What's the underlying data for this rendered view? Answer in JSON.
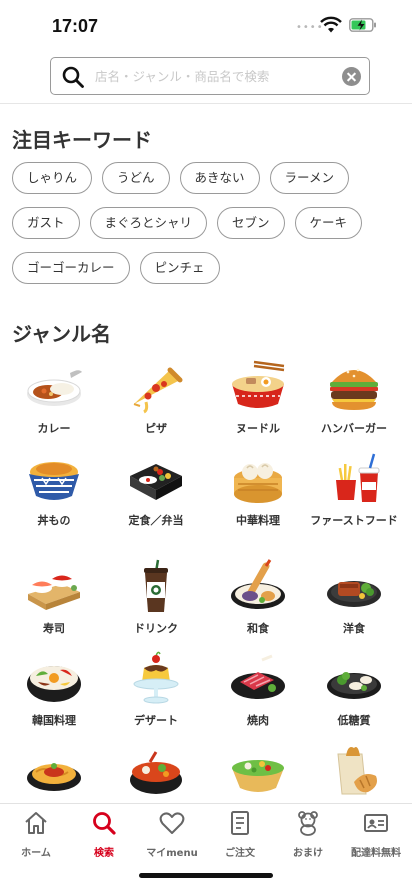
{
  "status": {
    "time": "17:07",
    "dots": "••••"
  },
  "search": {
    "placeholder": "店名・ジャンル・商品名で検索",
    "value": ""
  },
  "keywords": {
    "title": "注目キーワード",
    "items": [
      "しゃりん",
      "うどん",
      "あきない",
      "ラーメン",
      "ガスト",
      "まぐろとシャリ",
      "セブン",
      "ケーキ",
      "ゴーゴーカレー",
      "ピンチェ"
    ]
  },
  "genres": {
    "title": "ジャンル名",
    "items": [
      {
        "label": "カレー",
        "icon": "curry-icon"
      },
      {
        "label": "ピザ",
        "icon": "pizza-icon"
      },
      {
        "label": "ヌードル",
        "icon": "noodle-icon"
      },
      {
        "label": "ハンバーガー",
        "icon": "hamburger-icon"
      },
      {
        "label": "丼もの",
        "icon": "rice-bowl-icon"
      },
      {
        "label": "定食／弁当",
        "icon": "bento-icon"
      },
      {
        "label": "中華料理",
        "icon": "dim-sum-icon"
      },
      {
        "label": "ファーストフード",
        "icon": "fast-food-icon"
      },
      {
        "label": "寿司",
        "icon": "sushi-icon"
      },
      {
        "label": "ドリンク",
        "icon": "drink-icon"
      },
      {
        "label": "和食",
        "icon": "tempura-icon"
      },
      {
        "label": "洋食",
        "icon": "western-dish-icon"
      },
      {
        "label": "韓国料理",
        "icon": "bibimbap-icon"
      },
      {
        "label": "デザート",
        "icon": "pudding-icon"
      },
      {
        "label": "焼肉",
        "icon": "yakiniku-icon"
      },
      {
        "label": "低糖質",
        "icon": "low-carb-icon"
      },
      {
        "label": "",
        "icon": "pasta-icon"
      },
      {
        "label": "",
        "icon": "hot-pot-icon"
      },
      {
        "label": "",
        "icon": "salad-icon"
      },
      {
        "label": "",
        "icon": "bread-icon"
      }
    ]
  },
  "tabbar": {
    "active_color": "#d6001c",
    "items": [
      {
        "label": "ホーム",
        "icon": "home-icon"
      },
      {
        "label": "検索",
        "icon": "search-icon"
      },
      {
        "label": "マイmenu",
        "icon": "heart-icon"
      },
      {
        "label": "ご注文",
        "icon": "order-icon"
      },
      {
        "label": "おまけ",
        "icon": "bear-icon"
      },
      {
        "label": "配達料無料",
        "icon": "ticket-icon"
      }
    ]
  }
}
